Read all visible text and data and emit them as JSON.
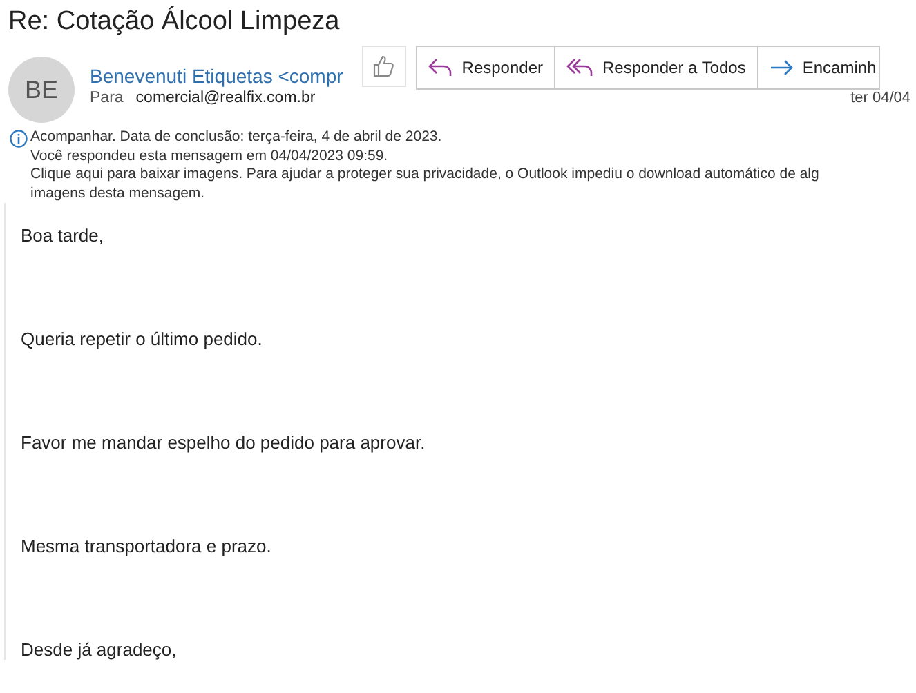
{
  "subject": "Re: Cotação Álcool Limpeza",
  "sender": {
    "initials": "BE",
    "name": "Benevenuti Etiquetas <compr",
    "to_label": "Para",
    "to": "comercial@realfix.com.br",
    "date": "ter 04/04"
  },
  "actions": [
    {
      "label": "Responder",
      "kind": "reply"
    },
    {
      "label": "Responder a Todos",
      "kind": "reply-all"
    },
    {
      "label": "Encaminh",
      "kind": "forward"
    }
  ],
  "info": [
    "Acompanhar.  Data de conclusão: terça-feira, 4 de abril de 2023.",
    "Você respondeu esta mensagem em 04/04/2023 09:59.",
    "Clique aqui para baixar imagens. Para ajudar a proteger sua privacidade, o Outlook impediu o download automático de alg",
    "imagens desta mensagem."
  ],
  "body": [
    "Boa tarde,",
    "Queria repetir o último pedido.",
    "Favor me mandar espelho do pedido para aprovar.",
    "Mesma transportadora e prazo.",
    "Desde já agradeço,"
  ]
}
